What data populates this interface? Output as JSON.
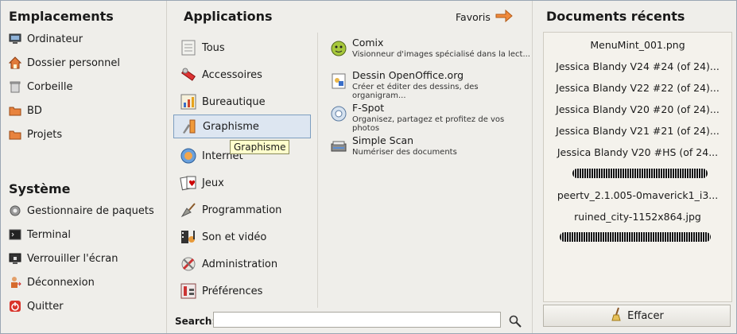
{
  "left": {
    "places_title": "Emplacements",
    "places": [
      {
        "label": "Ordinateur",
        "icon": "computer-icon"
      },
      {
        "label": "Dossier personnel",
        "icon": "home-folder-icon"
      },
      {
        "label": "Corbeille",
        "icon": "trash-icon"
      },
      {
        "label": "BD",
        "icon": "folder-icon"
      },
      {
        "label": "Projets",
        "icon": "folder-icon"
      }
    ],
    "system_title": "Système",
    "system": [
      {
        "label": "Gestionnaire de paquets",
        "icon": "gear-icon"
      },
      {
        "label": "Terminal",
        "icon": "terminal-icon"
      },
      {
        "label": "Verrouiller l'écran",
        "icon": "lock-screen-icon"
      },
      {
        "label": "Déconnexion",
        "icon": "logout-icon"
      },
      {
        "label": "Quitter",
        "icon": "power-icon"
      }
    ]
  },
  "middle": {
    "title": "Applications",
    "favorites_label": "Favoris",
    "categories": [
      {
        "label": "Tous",
        "icon": "all-apps-icon"
      },
      {
        "label": "Accessoires",
        "icon": "accessories-icon"
      },
      {
        "label": "Bureautique",
        "icon": "office-icon"
      },
      {
        "label": "Graphisme",
        "icon": "graphics-icon",
        "selected": true
      },
      {
        "label": "Internet",
        "icon": "internet-globe-icon"
      },
      {
        "label": "Jeux",
        "icon": "cards-icon"
      },
      {
        "label": "Programmation",
        "icon": "trowel-icon"
      },
      {
        "label": "Son et vidéo",
        "icon": "multimedia-icon"
      },
      {
        "label": "Administration",
        "icon": "admin-tools-icon"
      },
      {
        "label": "Préférences",
        "icon": "preferences-icon"
      }
    ],
    "tooltip": "Graphisme",
    "apps": [
      {
        "name": "Comix",
        "desc": "Visionneur d'images spécialisé dans la lect...",
        "icon": "comix-icon"
      },
      {
        "name": "Dessin OpenOffice.org",
        "desc": "Créer et éditer des dessins, des organigram...",
        "icon": "openoffice-draw-icon"
      },
      {
        "name": "F-Spot",
        "desc": "Organisez, partagez et profitez de vos photos",
        "icon": "fspot-icon"
      },
      {
        "name": "Simple Scan",
        "desc": "Numériser des documents",
        "icon": "scanner-icon"
      }
    ],
    "search_label": "Search:",
    "search_value": ""
  },
  "right": {
    "title": "Documents récents",
    "recent": [
      "MenuMint_001.png",
      "Jessica Blandy V24 #24 (of 24)...",
      "Jessica Blandy V22 #22 (of 24)...",
      "Jessica Blandy V20 #20 (of 24)...",
      "Jessica Blandy V21 #21 (of 24)...",
      "Jessica Blandy V20 #HS (of 24...",
      "",
      "peertv_2.1.005-0maverick1_i3...",
      "ruined_city-1152x864.jpg",
      ""
    ],
    "clear_label": "Effacer"
  }
}
